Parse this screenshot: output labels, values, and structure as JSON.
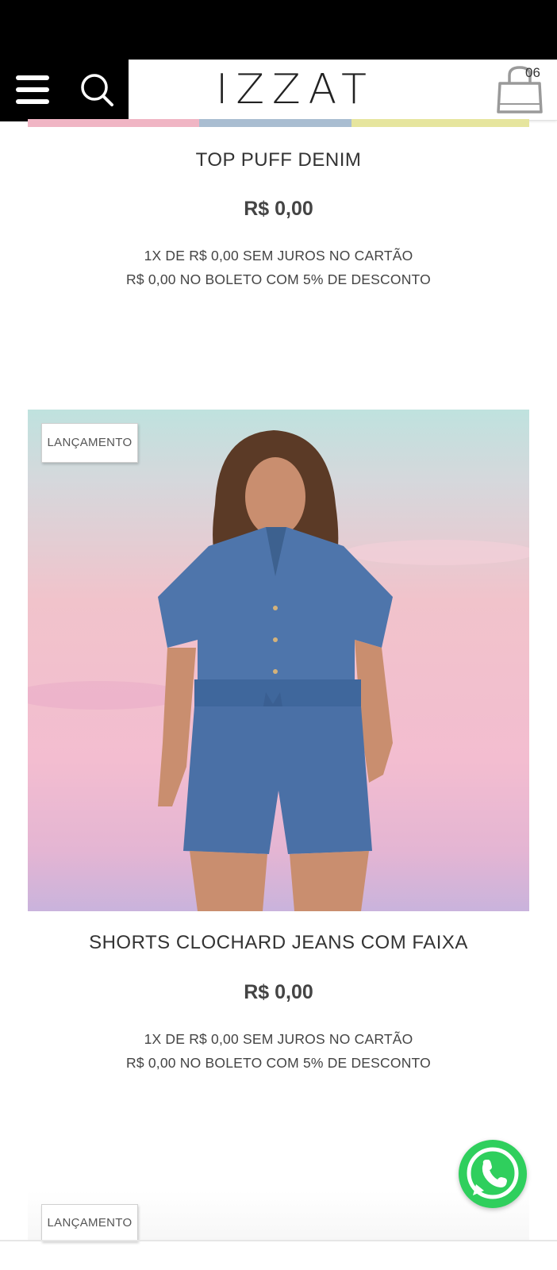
{
  "header": {
    "logo": "IZZAT",
    "cart_count": "06",
    "icons": {
      "menu": "hamburger-menu-icon",
      "search": "search-icon",
      "cart": "shopping-bag-icon"
    }
  },
  "products": [
    {
      "name": "TOP PUFF DENIM",
      "price": "R$ 0,00",
      "installment": "1X DE R$ 0,00 SEM JUROS NO CARTÃO",
      "boleto": "R$ 0,00 NO BOLETO COM 5% DE DESCONTO"
    },
    {
      "badge": "LANÇAMENTO",
      "name": "SHORTS CLOCHARD JEANS COM FAIXA",
      "price": "R$ 0,00",
      "installment": "1X DE R$ 0,00 SEM JUROS NO CARTÃO",
      "boleto": "R$ 0,00 NO BOLETO COM 5% DE DESCONTO"
    },
    {
      "badge": "LANÇAMENTO"
    }
  ],
  "floating": {
    "whatsapp_icon": "whatsapp-icon",
    "color": "#2fcf5d"
  },
  "colors": {
    "header_dark": "#000000",
    "text": "#333333"
  }
}
